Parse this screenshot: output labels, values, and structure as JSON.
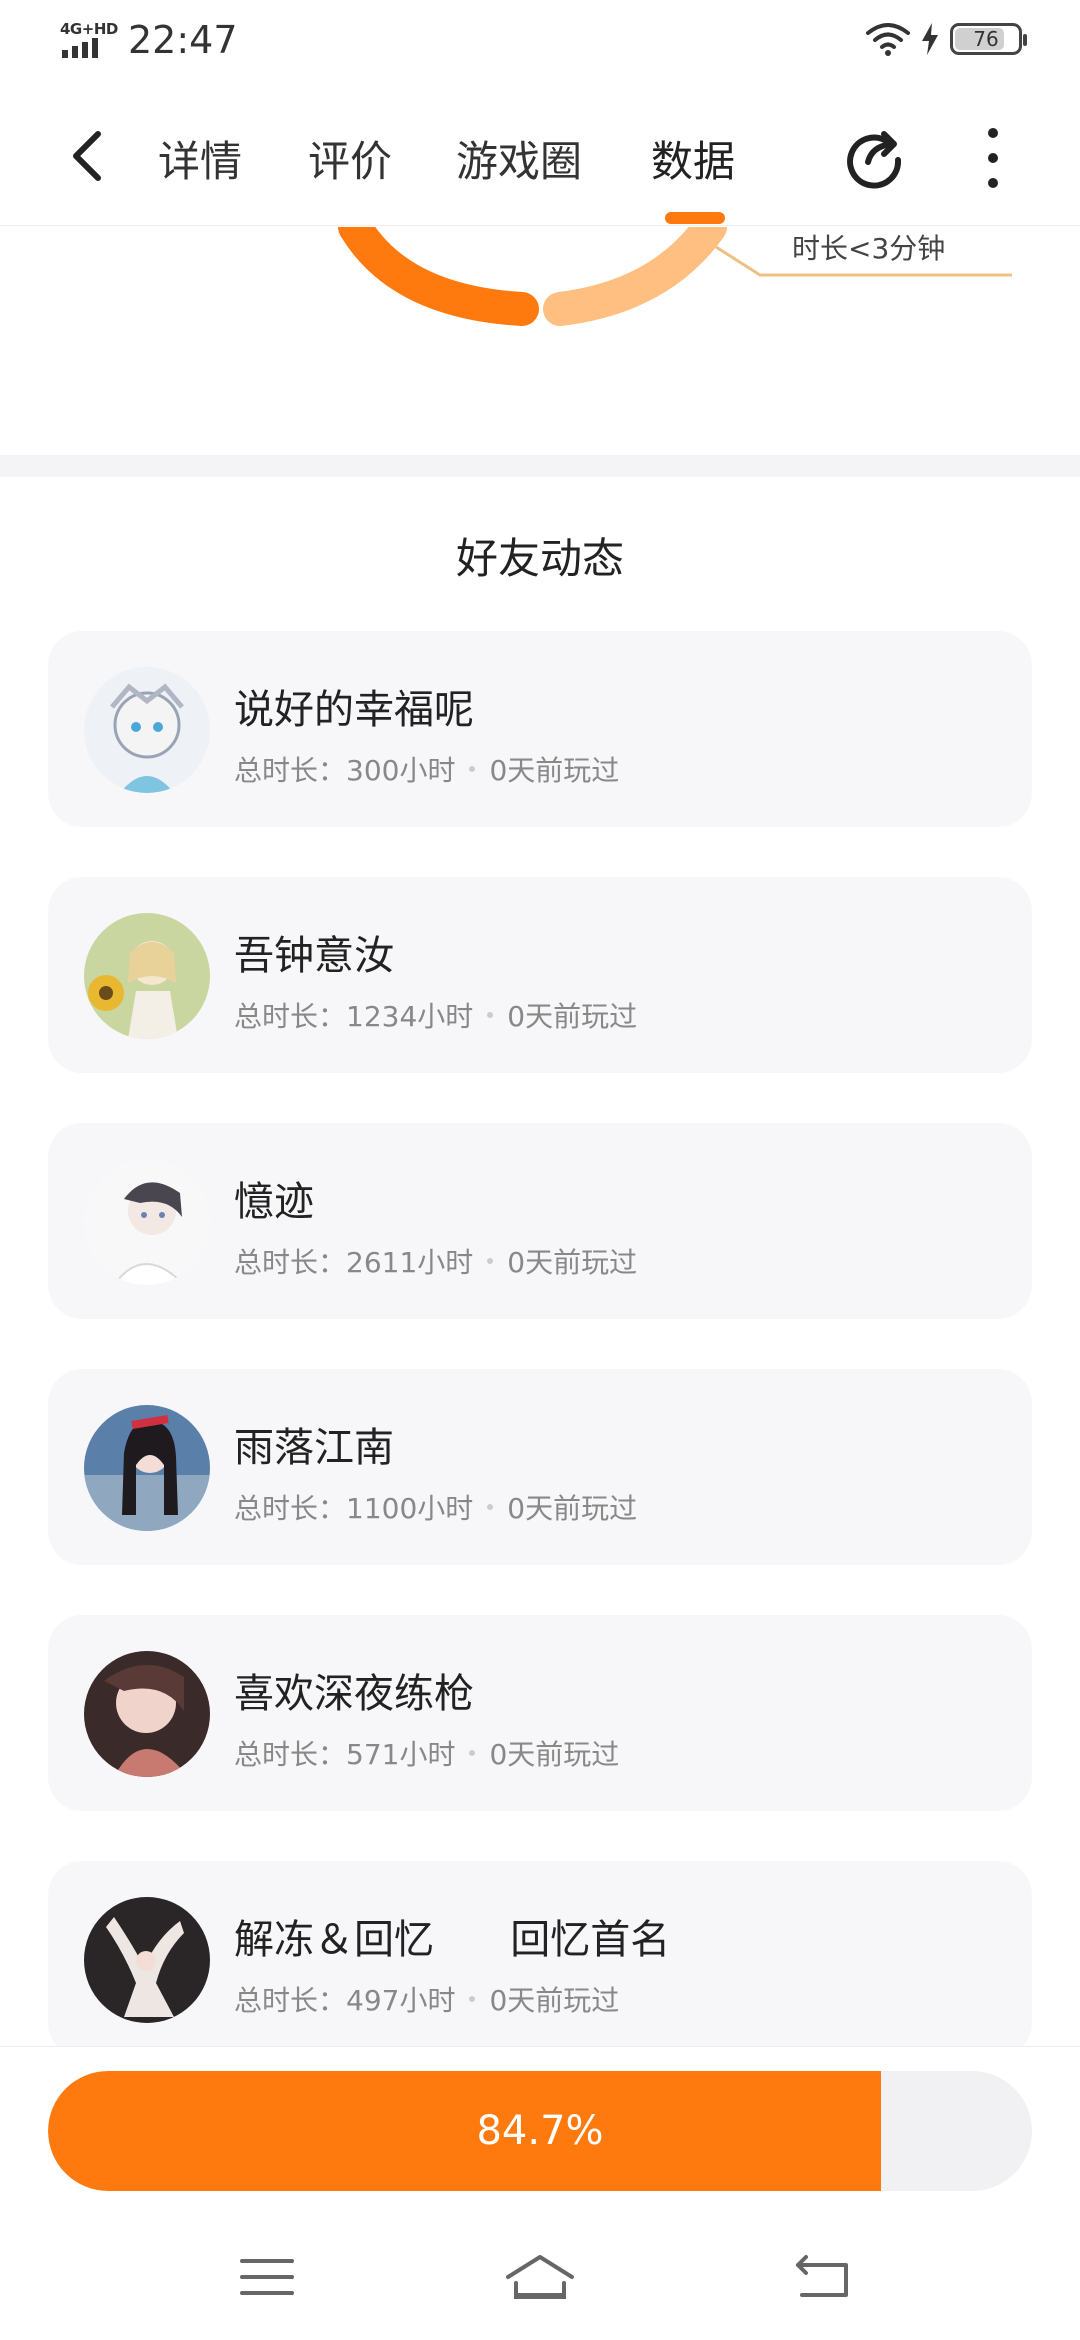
{
  "status_bar": {
    "network": "4G+HD",
    "time": "22:47",
    "battery": "76"
  },
  "nav": {
    "tabs": [
      {
        "label": "详情"
      },
      {
        "label": "评价"
      },
      {
        "label": "游戏圈"
      },
      {
        "label": "数据",
        "active": true
      }
    ]
  },
  "chart": {
    "legend_label": "时长<3分钟",
    "colors": [
      "#ff7a0e",
      "#ffbf80"
    ]
  },
  "friends": {
    "title": "好友动态",
    "items": [
      {
        "name": "说好的幸福呢",
        "total": "总时长：300小时",
        "last": "0天前玩过"
      },
      {
        "name": "吾钟意汝",
        "total": "总时长：1234小时",
        "last": "0天前玩过"
      },
      {
        "name": "憶迹",
        "total": "总时长：2611小时",
        "last": "0天前玩过"
      },
      {
        "name": "雨落江南",
        "total": "总时长：1100小时",
        "last": "0天前玩过"
      },
      {
        "name": "喜欢深夜练枪",
        "total": "总时长：571小时",
        "last": "0天前玩过"
      },
      {
        "name": "解冻＆回忆      回忆首名",
        "total": "总时长：497小时",
        "last": "0天前玩过"
      }
    ]
  },
  "progress": {
    "label": "84.7%",
    "value": 0.847,
    "color": "#ff7a0e"
  }
}
